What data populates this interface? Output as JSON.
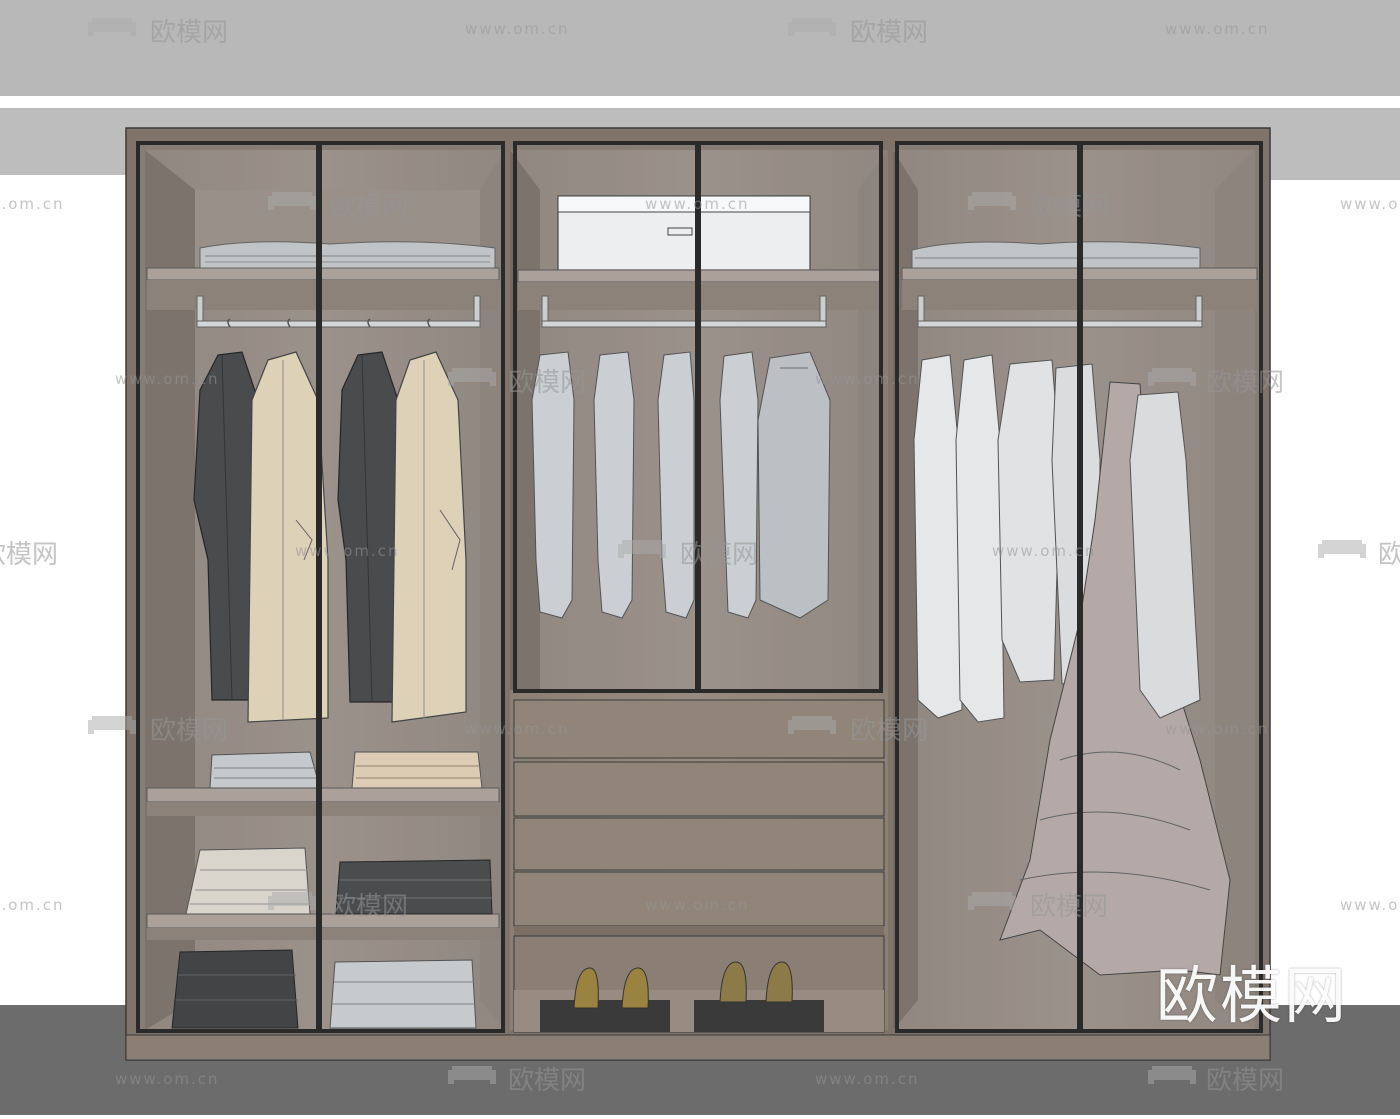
{
  "watermark": {
    "brand": "欧模网",
    "url": "www.om.cn"
  },
  "colors": {
    "wall": "#ffffff",
    "ceiling": "#b9b9b9",
    "floor": "#6e6e6e",
    "wood": "#8a7d72",
    "wood_dark": "#6f645b",
    "frame": "#2b2b2b",
    "glass": "rgba(180,190,195,0.18)"
  },
  "icons": [
    "sofa-logo-icon"
  ]
}
